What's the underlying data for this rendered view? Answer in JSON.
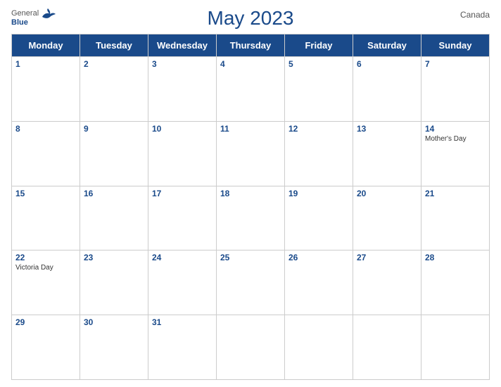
{
  "header": {
    "logo_general": "General",
    "logo_blue": "Blue",
    "title": "May 2023",
    "country": "Canada"
  },
  "days_of_week": [
    "Monday",
    "Tuesday",
    "Wednesday",
    "Thursday",
    "Friday",
    "Saturday",
    "Sunday"
  ],
  "weeks": [
    [
      {
        "num": "1",
        "holiday": ""
      },
      {
        "num": "2",
        "holiday": ""
      },
      {
        "num": "3",
        "holiday": ""
      },
      {
        "num": "4",
        "holiday": ""
      },
      {
        "num": "5",
        "holiday": ""
      },
      {
        "num": "6",
        "holiday": ""
      },
      {
        "num": "7",
        "holiday": ""
      }
    ],
    [
      {
        "num": "8",
        "holiday": ""
      },
      {
        "num": "9",
        "holiday": ""
      },
      {
        "num": "10",
        "holiday": ""
      },
      {
        "num": "11",
        "holiday": ""
      },
      {
        "num": "12",
        "holiday": ""
      },
      {
        "num": "13",
        "holiday": ""
      },
      {
        "num": "14",
        "holiday": "Mother's Day"
      }
    ],
    [
      {
        "num": "15",
        "holiday": ""
      },
      {
        "num": "16",
        "holiday": ""
      },
      {
        "num": "17",
        "holiday": ""
      },
      {
        "num": "18",
        "holiday": ""
      },
      {
        "num": "19",
        "holiday": ""
      },
      {
        "num": "20",
        "holiday": ""
      },
      {
        "num": "21",
        "holiday": ""
      }
    ],
    [
      {
        "num": "22",
        "holiday": "Victoria Day"
      },
      {
        "num": "23",
        "holiday": ""
      },
      {
        "num": "24",
        "holiday": ""
      },
      {
        "num": "25",
        "holiday": ""
      },
      {
        "num": "26",
        "holiday": ""
      },
      {
        "num": "27",
        "holiday": ""
      },
      {
        "num": "28",
        "holiday": ""
      }
    ],
    [
      {
        "num": "29",
        "holiday": ""
      },
      {
        "num": "30",
        "holiday": ""
      },
      {
        "num": "31",
        "holiday": ""
      },
      {
        "num": "",
        "holiday": ""
      },
      {
        "num": "",
        "holiday": ""
      },
      {
        "num": "",
        "holiday": ""
      },
      {
        "num": "",
        "holiday": ""
      }
    ]
  ]
}
